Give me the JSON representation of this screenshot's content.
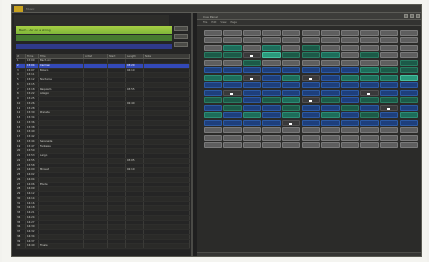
{
  "app": {
    "top_title": "Music"
  },
  "left_panel": {
    "green_header": "Bach - Air on a string",
    "grid_columns": [
      "#",
      "Time",
      "Title",
      "Artist",
      "Start",
      "Length",
      "Note"
    ],
    "rows": [
      {
        "cells": [
          "1",
          "15:00",
          "Bach Air",
          "",
          "",
          "",
          ""
        ],
        "selected": false
      },
      {
        "cells": [
          "2",
          "15:04",
          "Carmen",
          "",
          "",
          "03:20",
          ""
        ],
        "selected": true
      },
      {
        "cells": [
          "3",
          "15:07",
          "Bolero",
          "",
          "",
          "04:10",
          ""
        ],
        "selected": false
      },
      {
        "cells": [
          "4",
          "15:11",
          "",
          "",
          "",
          "",
          ""
        ],
        "selected": false
      },
      {
        "cells": [
          "5",
          "15:12",
          "Nocturne",
          "",
          "",
          "",
          ""
        ],
        "selected": false
      },
      {
        "cells": [
          "6",
          "15:15",
          "",
          "",
          "",
          "",
          ""
        ],
        "selected": false
      },
      {
        "cells": [
          "7",
          "15:18",
          "Requiem",
          "",
          "",
          "03:55",
          ""
        ],
        "selected": false
      },
      {
        "cells": [
          "8",
          "15:22",
          "Adagio",
          "",
          "",
          "",
          ""
        ],
        "selected": false
      },
      {
        "cells": [
          "9",
          "15:25",
          "",
          "",
          "",
          "",
          ""
        ],
        "selected": false
      },
      {
        "cells": [
          "10",
          "15:26",
          "",
          "",
          "",
          "02:40",
          ""
        ],
        "selected": false
      },
      {
        "cells": [
          "11",
          "15:28",
          "",
          "",
          "",
          "",
          ""
        ],
        "selected": false
      },
      {
        "cells": [
          "12",
          "15:30",
          "Prelude",
          "",
          "",
          "",
          ""
        ],
        "selected": false
      },
      {
        "cells": [
          "13",
          "15:34",
          "",
          "",
          "",
          "",
          ""
        ],
        "selected": false
      },
      {
        "cells": [
          "14",
          "15:36",
          "",
          "",
          "",
          "",
          ""
        ],
        "selected": false
      },
      {
        "cells": [
          "15",
          "15:38",
          "",
          "",
          "",
          "",
          ""
        ],
        "selected": false
      },
      {
        "cells": [
          "16",
          "15:40",
          "",
          "",
          "",
          "",
          ""
        ],
        "selected": false
      },
      {
        "cells": [
          "17",
          "15:42",
          "",
          "",
          "",
          "",
          ""
        ],
        "selected": false
      },
      {
        "cells": [
          "18",
          "15:44",
          "Serenade",
          "",
          "",
          "",
          ""
        ],
        "selected": false
      },
      {
        "cells": [
          "19",
          "15:47",
          "Fantasia",
          "",
          "",
          "",
          ""
        ],
        "selected": false
      },
      {
        "cells": [
          "20",
          "15:50",
          "",
          "",
          "",
          "",
          ""
        ],
        "selected": false
      },
      {
        "cells": [
          "21",
          "15:53",
          "Largo",
          "",
          "",
          "",
          ""
        ],
        "selected": false
      },
      {
        "cells": [
          "22",
          "15:55",
          "",
          "",
          "",
          "03:05",
          ""
        ],
        "selected": false
      },
      {
        "cells": [
          "23",
          "15:58",
          "",
          "",
          "",
          "",
          ""
        ],
        "selected": false
      },
      {
        "cells": [
          "24",
          "16:00",
          "Minuet",
          "",
          "",
          "02:10",
          ""
        ],
        "selected": false
      },
      {
        "cells": [
          "25",
          "16:02",
          "",
          "",
          "",
          "",
          ""
        ],
        "selected": false
      },
      {
        "cells": [
          "26",
          "16:04",
          "",
          "",
          "",
          "",
          ""
        ],
        "selected": false
      },
      {
        "cells": [
          "27",
          "16:06",
          "Etude",
          "",
          "",
          "",
          ""
        ],
        "selected": false
      },
      {
        "cells": [
          "28",
          "16:09",
          "",
          "",
          "",
          "",
          ""
        ],
        "selected": false
      },
      {
        "cells": [
          "29",
          "16:12",
          "",
          "",
          "",
          "",
          ""
        ],
        "selected": false
      },
      {
        "cells": [
          "30",
          "16:14",
          "",
          "",
          "",
          "",
          ""
        ],
        "selected": false
      },
      {
        "cells": [
          "31",
          "16:16",
          "",
          "",
          "",
          "",
          ""
        ],
        "selected": false
      },
      {
        "cells": [
          "32",
          "16:18",
          "",
          "",
          "",
          "",
          ""
        ],
        "selected": false
      },
      {
        "cells": [
          "33",
          "16:21",
          "",
          "",
          "",
          "",
          ""
        ],
        "selected": false
      },
      {
        "cells": [
          "34",
          "16:24",
          "",
          "",
          "",
          "",
          ""
        ],
        "selected": false
      },
      {
        "cells": [
          "35",
          "16:27",
          "",
          "",
          "",
          "",
          ""
        ],
        "selected": false
      },
      {
        "cells": [
          "36",
          "16:30",
          "",
          "",
          "",
          "",
          ""
        ],
        "selected": false
      },
      {
        "cells": [
          "37",
          "16:32",
          "",
          "",
          "",
          "",
          ""
        ],
        "selected": false
      },
      {
        "cells": [
          "38",
          "16:34",
          "",
          "",
          "",
          "",
          ""
        ],
        "selected": false
      },
      {
        "cells": [
          "39",
          "16:37",
          "",
          "",
          "",
          "",
          ""
        ],
        "selected": false
      },
      {
        "cells": [
          "40",
          "16:40",
          "Finale",
          "",
          "",
          "",
          ""
        ],
        "selected": false
      }
    ]
  },
  "right_panel": {
    "title": "Cue Panel",
    "toolbar": [
      "File",
      "Edit",
      "View",
      "Page"
    ],
    "cells": [
      "gray",
      "gray",
      "gray",
      "gray",
      "gray",
      "gray",
      "gray",
      "gray",
      "gray",
      "gray",
      "gray",
      "gray",
      "gray",
      "gray",
      "gray",
      "gray",
      "gray",
      "gray",
      "gray",
      "gray",
      "gray",
      "gray",
      "gray",
      "teal",
      "gray",
      "teal",
      "gray",
      "green",
      "gray",
      "gray",
      "gray",
      "gray",
      "gray",
      "green",
      "green",
      "white",
      "bright",
      "green",
      "green",
      "teal",
      "gray",
      "green",
      "gray",
      "gray",
      "gray",
      "gray",
      "green",
      "gray",
      "gray",
      "gray",
      "gray",
      "gray",
      "gray",
      "gray",
      "green",
      "blue",
      "blue",
      "blue",
      "blue",
      "blue",
      "blue",
      "blue",
      "blue",
      "teal",
      "green",
      "green",
      "teal",
      "teal",
      "white",
      "blue",
      "teal",
      "white",
      "blue",
      "teal",
      "teal",
      "teal",
      "bright",
      "blue",
      "blue",
      "blue",
      "blue",
      "blue",
      "blue",
      "blue",
      "blue",
      "blue",
      "blue",
      "blue",
      "blue",
      "white",
      "blue",
      "blue",
      "blue",
      "blue",
      "blue",
      "blue",
      "white",
      "blue",
      "blue",
      "green",
      "green",
      "blue",
      "green",
      "teal",
      "white",
      "green",
      "blue",
      "green",
      "green",
      "green",
      "blue",
      "green",
      "blue",
      "blue",
      "green",
      "blue",
      "blue",
      "green",
      "blue",
      "white",
      "blue",
      "teal",
      "blue",
      "teal",
      "blue",
      "teal",
      "blue",
      "teal",
      "blue",
      "green",
      "blue",
      "teal",
      "blue",
      "blue",
      "blue",
      "blue",
      "white",
      "blue",
      "blue",
      "blue",
      "blue",
      "blue",
      "blue",
      "gray",
      "gray",
      "gray",
      "gray",
      "gray",
      "gray",
      "gray",
      "gray",
      "gray",
      "gray",
      "gray",
      "gray",
      "gray",
      "gray",
      "gray",
      "gray",
      "gray",
      "gray",
      "gray",
      "gray",
      "gray",
      "gray",
      "gray",
      "gray",
      "gray",
      "gray",
      "gray",
      "gray",
      "gray",
      "gray",
      "gray",
      "gray",
      "gray"
    ]
  }
}
